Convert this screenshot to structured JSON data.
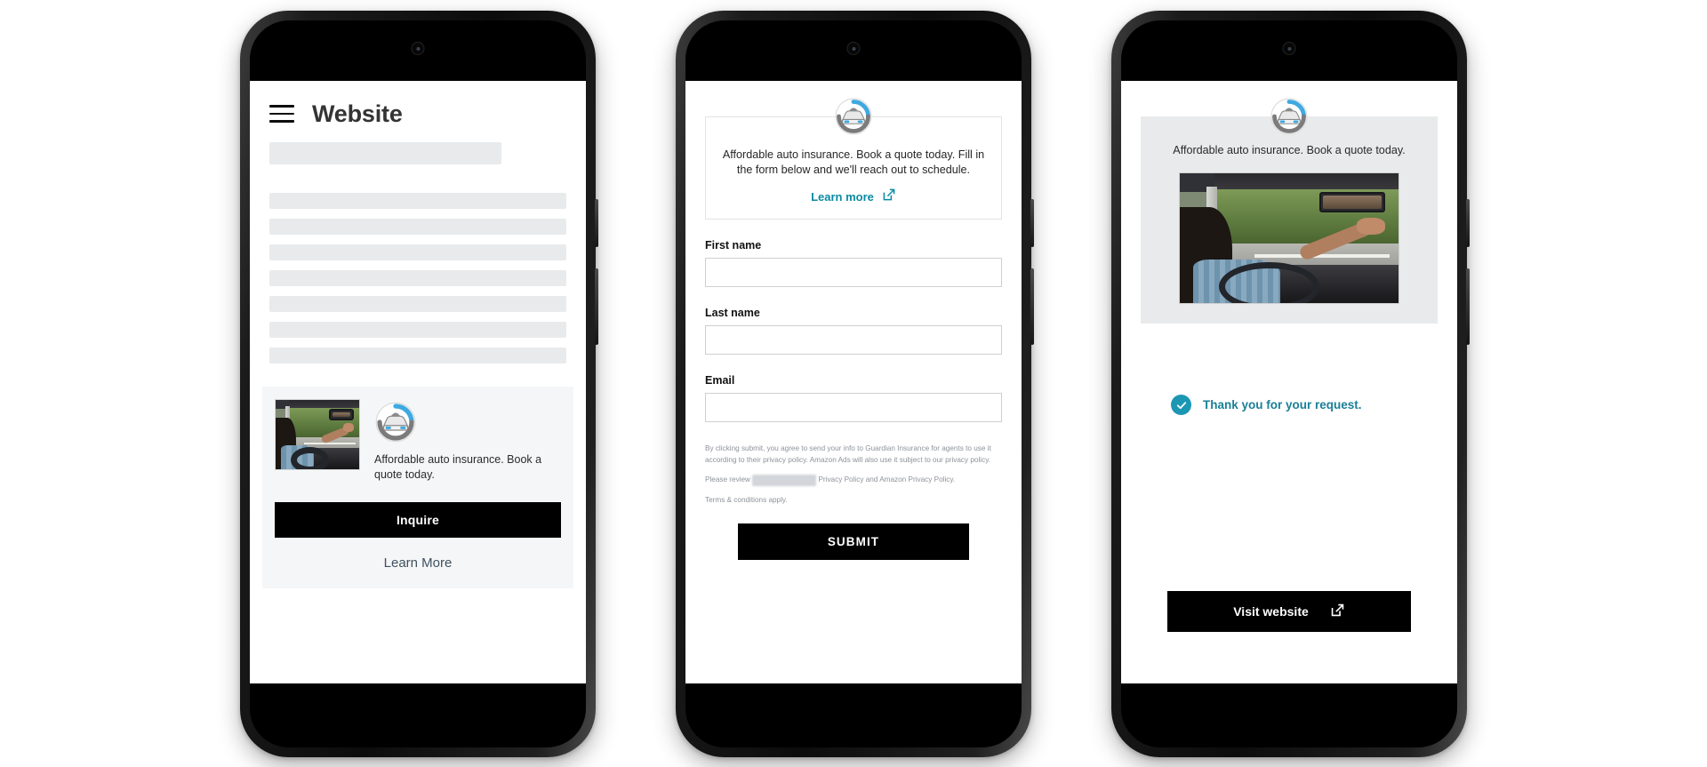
{
  "phone1": {
    "name": "website-with-ad-unit",
    "header": {
      "title": "Website",
      "menu_icon": "hamburger-menu-icon"
    },
    "skeleton": {
      "lead_bar": "",
      "rows": [
        "",
        "",
        "",
        "",
        "",
        "",
        ""
      ]
    },
    "ad": {
      "logo_icon": "car-shield-brand-logo",
      "photo_alt": "woman driving car adjusting rear view mirror",
      "copy": "Affordable auto insurance. Book a quote today.",
      "inquire_label": "Inquire",
      "learn_more_label": "Learn More"
    }
  },
  "phone2": {
    "name": "lead-form-screen",
    "logo_icon": "car-shield-brand-logo",
    "promo": {
      "text": "Affordable auto insurance. Book a quote today. Fill in the form below and we'll reach out to schedule.",
      "link_label": "Learn more",
      "link_icon": "external-link-icon"
    },
    "fields": [
      {
        "label": "First name",
        "value": "",
        "placeholder": "",
        "name": "first-name-field"
      },
      {
        "label": "Last name",
        "value": "",
        "placeholder": "",
        "name": "last-name-field"
      },
      {
        "label": "Email",
        "value": "",
        "placeholder": "",
        "name": "email-field"
      }
    ],
    "legal": {
      "disclaimer": "By clicking submit, you agree to send your info to Guardian Insurance for agents to use it according to their privacy policy. Amazon Ads will also use it subject to our privacy policy.",
      "review_prefix": "Please review",
      "brand_redacted": "Guardian Insurance",
      "brand_privacy_link": "Privacy Policy",
      "and_text": "and",
      "amazon_privacy_link": "Amazon Privacy Policy.",
      "terms": "Terms & conditions apply."
    },
    "submit_label": "SUBMIT"
  },
  "phone3": {
    "name": "confirmation-screen",
    "logo_icon": "car-shield-brand-logo",
    "hero": {
      "text": "Affordable auto insurance. Book a quote today.",
      "photo_alt": "woman driving car adjusting rear view mirror"
    },
    "confirmation": {
      "check_icon": "check-circle-icon",
      "message": "Thank you for your request."
    },
    "visit_button": {
      "label": "Visit website",
      "icon": "external-link-icon"
    }
  },
  "colors": {
    "accent_teal": "#0a8ba3",
    "confirm_teal": "#1b97b4",
    "button_black": "#000000",
    "skeleton_gray": "#e8eaec",
    "card_gray": "#f5f6f7",
    "hero_gray": "#e8eaeb",
    "link_slate": "#3e5060",
    "logo_blue": "#3fa9e0",
    "logo_gray": "#7b7b7b"
  }
}
